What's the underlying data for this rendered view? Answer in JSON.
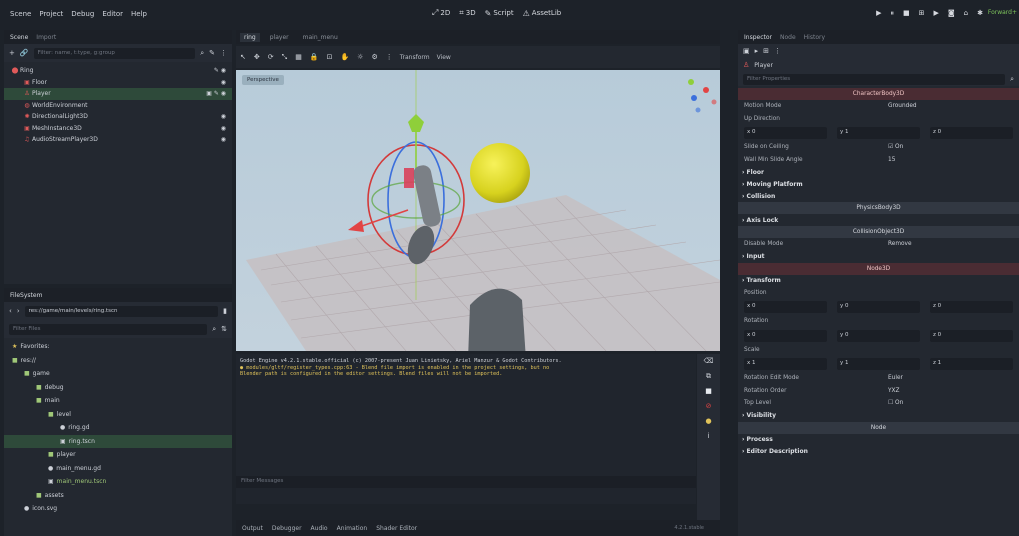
{
  "menu": [
    "Scene",
    "Project",
    "Debug",
    "Editor",
    "Help"
  ],
  "workspaces": [
    {
      "icon": "2d-icon",
      "glyph": "⤢",
      "label": "2D"
    },
    {
      "icon": "3d-icon",
      "glyph": "⌗",
      "label": "3D"
    },
    {
      "icon": "script-icon",
      "glyph": "✎",
      "label": "Script"
    },
    {
      "icon": "assetlib-icon",
      "glyph": "⚠",
      "label": "AssetLib"
    }
  ],
  "run_buttons": [
    "▶",
    "⏸",
    "■",
    "⊞",
    "▶",
    "◙",
    "⌂",
    "✱"
  ],
  "renderer": "Forward+",
  "scene_dock": {
    "tabs": [
      "Scene",
      "Import"
    ],
    "filter_placeholder": "Filter: name, t:type, g:group",
    "nodes": [
      {
        "name": "Ring",
        "depth": 0,
        "icon_color": "#e05a5a",
        "glyph": "⬤",
        "right": "✎ ◉",
        "selected": false
      },
      {
        "name": "Floor",
        "depth": 1,
        "icon_color": "#e05a5a",
        "glyph": "▣",
        "right": "◉",
        "selected": false
      },
      {
        "name": "Player",
        "depth": 1,
        "icon_color": "#e05a5a",
        "glyph": "♙",
        "right": "▣ ✎ ◉",
        "selected": true
      },
      {
        "name": "WorldEnvironment",
        "depth": 1,
        "icon_color": "#e05a5a",
        "glyph": "◍",
        "right": "",
        "selected": false
      },
      {
        "name": "DirectionalLight3D",
        "depth": 1,
        "icon_color": "#e05a5a",
        "glyph": "✺",
        "right": "◉",
        "selected": false
      },
      {
        "name": "MeshInstance3D",
        "depth": 1,
        "icon_color": "#e05a5a",
        "glyph": "▣",
        "right": "◉",
        "selected": false
      },
      {
        "name": "AudioStreamPlayer3D",
        "depth": 1,
        "icon_color": "#e05a5a",
        "glyph": "♫",
        "right": "◉",
        "selected": false
      }
    ]
  },
  "filesystem": {
    "tab": "FileSystem",
    "path": "res://game/main/levels/ring.tscn",
    "filter_placeholder": "Filter Files",
    "items": [
      {
        "name": "Favorites:",
        "depth": 0,
        "type": "fav"
      },
      {
        "name": "res://",
        "depth": 0,
        "type": "folder"
      },
      {
        "name": "game",
        "depth": 1,
        "type": "folder"
      },
      {
        "name": "debug",
        "depth": 2,
        "type": "folder"
      },
      {
        "name": "main",
        "depth": 2,
        "type": "folder"
      },
      {
        "name": "level",
        "depth": 3,
        "type": "folder"
      },
      {
        "name": "ring.gd",
        "depth": 4,
        "type": "file"
      },
      {
        "name": "ring.tscn",
        "depth": 4,
        "type": "scene",
        "selected": true
      },
      {
        "name": "player",
        "depth": 3,
        "type": "folder"
      },
      {
        "name": "main_menu.gd",
        "depth": 3,
        "type": "file"
      },
      {
        "name": "main_menu.tscn",
        "depth": 3,
        "type": "scene"
      },
      {
        "name": "assets",
        "depth": 2,
        "type": "folder"
      },
      {
        "name": "icon.svg",
        "depth": 1,
        "type": "file"
      }
    ]
  },
  "editor_tabs": [
    "ring",
    "player",
    "main_menu"
  ],
  "viewport": {
    "toolbar_glyphs": [
      "↖",
      "✥",
      "⟳",
      "⤡",
      "▦",
      "🔒",
      "⊡",
      "✋",
      "☼",
      "⚙",
      "⋮"
    ],
    "transform_label": "Transform",
    "view_label": "View",
    "perspective_label": "Perspective"
  },
  "output": {
    "lines": [
      {
        "text": "Godot Engine v4.2.1.stable.official (c) 2007-present Juan Linietsky, Ariel Manzur & Godot Contributors.",
        "warn": false
      },
      {
        "text": "● modules/gltf/register_types.cpp:63 - Blend file import is enabled in the project settings, but no",
        "warn": true
      },
      {
        "text": "Blender path is configured in the editor settings. Blend files will not be imported.",
        "warn": true
      }
    ],
    "filter_placeholder": "Filter Messages",
    "version": "4.2.1.stable"
  },
  "bottom_tabs": [
    "Output",
    "Debugger",
    "Audio",
    "Animation",
    "Shader Editor"
  ],
  "inspector": {
    "tabs": [
      "Inspector",
      "Node",
      "History"
    ],
    "node_name": "Player",
    "filter_placeholder": "Filter Properties",
    "rows": [
      {
        "kind": "section",
        "label": "CharacterBody3D",
        "red": true
      },
      {
        "kind": "prop",
        "label": "Motion Mode",
        "value": "Grounded"
      },
      {
        "kind": "prop",
        "label": "Up Direction",
        "value": ""
      },
      {
        "kind": "vec",
        "values": [
          "x 0",
          "y 1",
          "z 0"
        ]
      },
      {
        "kind": "prop",
        "label": "Slide on Ceiling",
        "value": "☑ On"
      },
      {
        "kind": "prop",
        "label": "Wall Min Slide Angle",
        "value": "15"
      },
      {
        "kind": "group",
        "label": "Floor"
      },
      {
        "kind": "group",
        "label": "Moving Platform"
      },
      {
        "kind": "group",
        "label": "Collision"
      },
      {
        "kind": "section",
        "label": "PhysicsBody3D",
        "red": false
      },
      {
        "kind": "group",
        "label": "Axis Lock"
      },
      {
        "kind": "section",
        "label": "CollisionObject3D",
        "red": false
      },
      {
        "kind": "prop",
        "label": "Disable Mode",
        "value": "Remove"
      },
      {
        "kind": "group",
        "label": "Input"
      },
      {
        "kind": "section",
        "label": "Node3D",
        "red": true
      },
      {
        "kind": "group",
        "label": "Transform"
      },
      {
        "kind": "prop",
        "label": "Position",
        "value": ""
      },
      {
        "kind": "vec",
        "values": [
          "x 0",
          "y 0",
          "z 0"
        ]
      },
      {
        "kind": "prop",
        "label": "Rotation",
        "value": ""
      },
      {
        "kind": "vec",
        "values": [
          "x 0",
          "y 0",
          "z 0"
        ]
      },
      {
        "kind": "prop",
        "label": "Scale",
        "value": ""
      },
      {
        "kind": "vec",
        "values": [
          "x 1",
          "y 1",
          "z 1"
        ]
      },
      {
        "kind": "prop",
        "label": "Rotation Edit Mode",
        "value": "Euler"
      },
      {
        "kind": "prop",
        "label": "Rotation Order",
        "value": "YXZ"
      },
      {
        "kind": "prop",
        "label": "Top Level",
        "value": "☐ On"
      },
      {
        "kind": "group",
        "label": "Visibility"
      },
      {
        "kind": "section",
        "label": "Node",
        "red": false
      },
      {
        "kind": "group",
        "label": "Process"
      },
      {
        "kind": "group",
        "label": "Editor Description"
      }
    ]
  }
}
